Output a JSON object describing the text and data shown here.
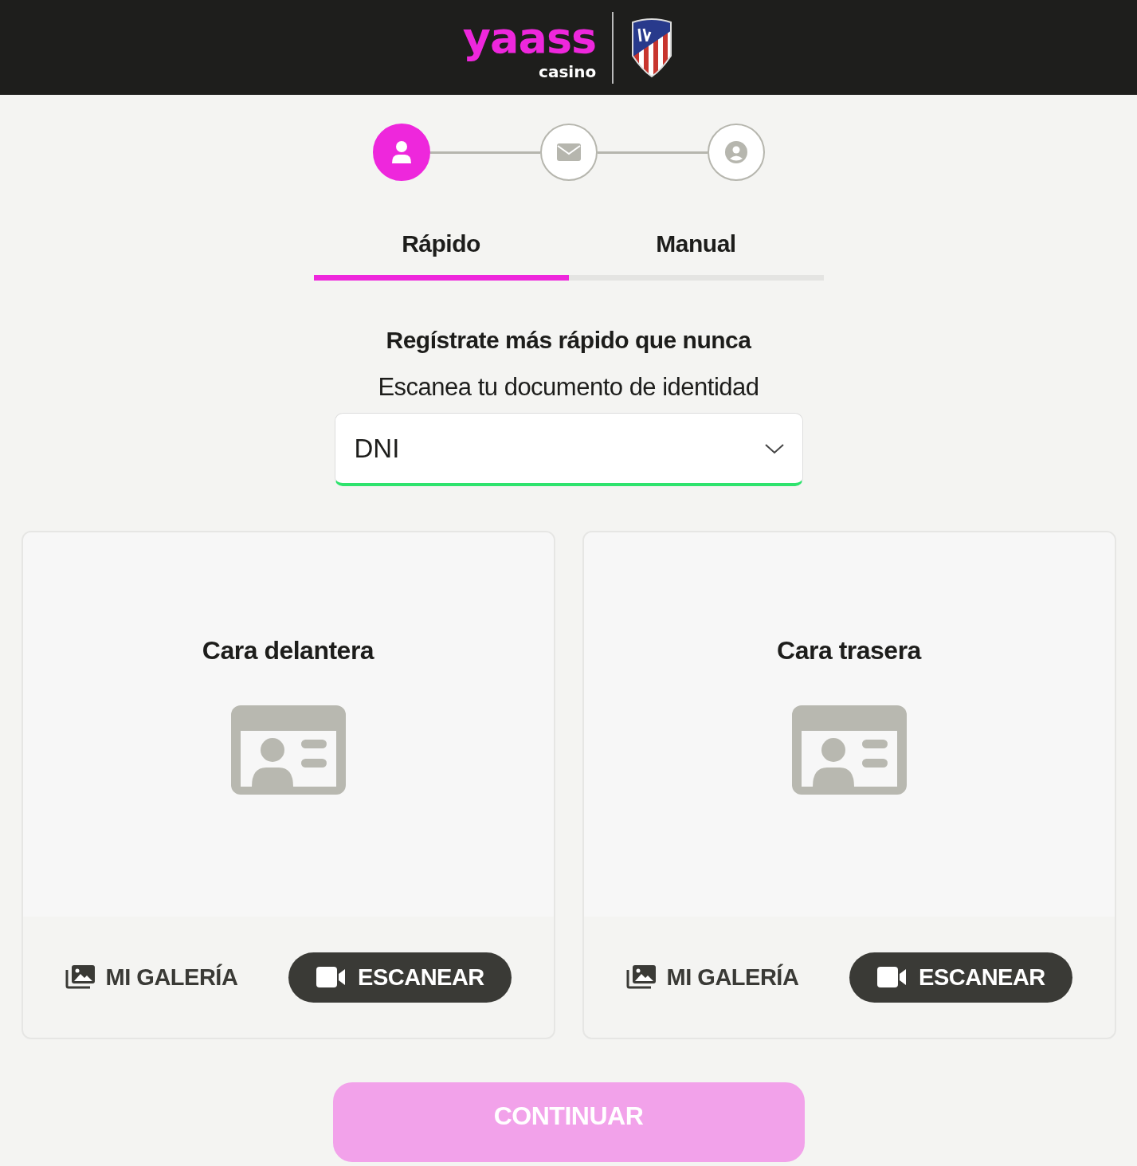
{
  "header": {
    "logo_text": "yaass",
    "logo_subtext": "casino"
  },
  "steps": [
    {
      "kind": "user",
      "selected": true
    },
    {
      "kind": "mail",
      "selected": false
    },
    {
      "kind": "account",
      "selected": false
    }
  ],
  "tabs": [
    {
      "label": "Rápido",
      "selected": true
    },
    {
      "label": "Manual",
      "selected": false
    }
  ],
  "heading": "Regístrate más rápido que nunca",
  "subheading": "Escanea tu documento de identidad",
  "document_select": {
    "value": "DNI"
  },
  "cards": [
    {
      "title": "Cara delantera",
      "gallery_label": "MI GALERÍA",
      "scan_label": "ESCANEAR"
    },
    {
      "title": "Cara trasera",
      "gallery_label": "MI GALERÍA",
      "scan_label": "ESCANEAR"
    }
  ],
  "continue_button": {
    "label": "CONTINUAR",
    "disabled": true
  }
}
